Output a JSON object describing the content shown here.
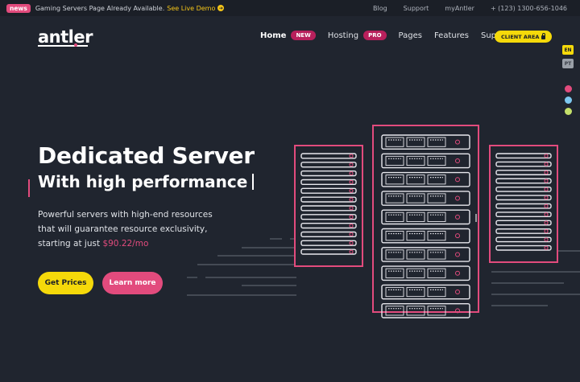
{
  "topbar": {
    "news_badge": "news",
    "news_text": "Gaming Servers Page Already Available.",
    "news_link": "See Live Demo",
    "links": [
      "Blog",
      "Support",
      "myAntler",
      "+ (123) 1300-656-1046"
    ]
  },
  "logo": {
    "text": "antler"
  },
  "nav": {
    "items": [
      {
        "label": "Home",
        "badge": "NEW"
      },
      {
        "label": "Hosting",
        "badge": "PRO"
      },
      {
        "label": "Pages"
      },
      {
        "label": "Features"
      },
      {
        "label": "Support"
      }
    ],
    "client_area": "CLIENT AREA"
  },
  "languages": [
    "EN",
    "PT"
  ],
  "theme_colors": [
    "#e24b7d",
    "#7dc8f0",
    "#c4e06a"
  ],
  "hero": {
    "title": "Dedicated Server",
    "subtitle": "With high performance",
    "desc_line1": "Powerful servers with high-end resources",
    "desc_line2": "that will guarantee resource exclusivity,",
    "desc_line3_prefix": "starting at just",
    "price": "$90.22/mo",
    "btn_get": "Get Prices",
    "btn_learn": "Learn more"
  },
  "colors": {
    "accent_pink": "#e24b7d",
    "accent_yellow": "#f5d90a",
    "background": "#20252f"
  }
}
